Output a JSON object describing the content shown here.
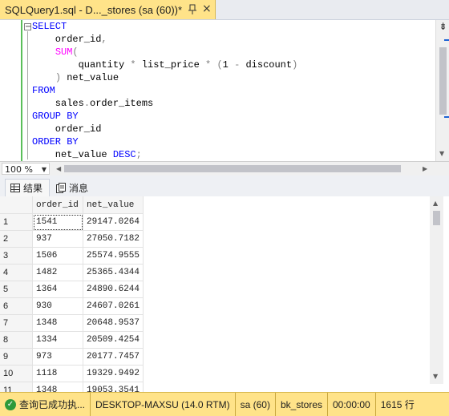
{
  "tab": {
    "title": "SQLQuery1.sql - D..._stores (sa (60))*",
    "close": "×"
  },
  "editor": {
    "lines": [
      [
        {
          "t": "SELECT",
          "c": "kw"
        }
      ],
      [
        {
          "t": "    order_id",
          "c": "plain"
        },
        {
          "t": ",",
          "c": "op"
        }
      ],
      [
        {
          "t": "    ",
          "c": "plain"
        },
        {
          "t": "SUM",
          "c": "fn"
        },
        {
          "t": "(",
          "c": "op"
        }
      ],
      [
        {
          "t": "        quantity ",
          "c": "plain"
        },
        {
          "t": "*",
          "c": "op"
        },
        {
          "t": " list_price ",
          "c": "plain"
        },
        {
          "t": "*",
          "c": "op"
        },
        {
          "t": " ",
          "c": "plain"
        },
        {
          "t": "(",
          "c": "op"
        },
        {
          "t": "1 ",
          "c": "plain"
        },
        {
          "t": "-",
          "c": "op"
        },
        {
          "t": " discount",
          "c": "plain"
        },
        {
          "t": ")",
          "c": "op"
        }
      ],
      [
        {
          "t": "    ",
          "c": "plain"
        },
        {
          "t": ")",
          "c": "op"
        },
        {
          "t": " net_value",
          "c": "plain"
        }
      ],
      [
        {
          "t": "FROM",
          "c": "kw"
        }
      ],
      [
        {
          "t": "    sales",
          "c": "plain"
        },
        {
          "t": ".",
          "c": "op"
        },
        {
          "t": "order_items",
          "c": "plain"
        }
      ],
      [
        {
          "t": "GROUP BY",
          "c": "kw"
        }
      ],
      [
        {
          "t": "    order_id",
          "c": "plain"
        }
      ],
      [
        {
          "t": "ORDER BY",
          "c": "kw"
        }
      ],
      [
        {
          "t": "    net_value ",
          "c": "plain"
        },
        {
          "t": "DESC",
          "c": "kw"
        },
        {
          "t": ";",
          "c": "op"
        }
      ]
    ]
  },
  "zoom": {
    "value": "100 %"
  },
  "results_tabs": {
    "results": "结果",
    "messages": "消息"
  },
  "grid": {
    "columns": [
      "order_id",
      "net_value"
    ],
    "rows": [
      {
        "n": "1",
        "order_id": "1541",
        "net_value": "29147.0264"
      },
      {
        "n": "2",
        "order_id": "937",
        "net_value": "27050.7182"
      },
      {
        "n": "3",
        "order_id": "1506",
        "net_value": "25574.9555"
      },
      {
        "n": "4",
        "order_id": "1482",
        "net_value": "25365.4344"
      },
      {
        "n": "5",
        "order_id": "1364",
        "net_value": "24890.6244"
      },
      {
        "n": "6",
        "order_id": "930",
        "net_value": "24607.0261"
      },
      {
        "n": "7",
        "order_id": "1348",
        "net_value": "20648.9537"
      },
      {
        "n": "8",
        "order_id": "1334",
        "net_value": "20509.4254"
      },
      {
        "n": "9",
        "order_id": "973",
        "net_value": "20177.7457"
      },
      {
        "n": "10",
        "order_id": "1118",
        "net_value": "19329.9492"
      },
      {
        "n": "11",
        "order_id": "1348",
        "net_value": "19053.3541"
      }
    ]
  },
  "status": {
    "message": "查询已成功执...",
    "server": "DESKTOP-MAXSU (14.0 RTM)",
    "user": "sa (60)",
    "database": "bk_stores",
    "time": "00:00:00",
    "rows": "1615 行"
  },
  "colors": {
    "accent": "#ffe389",
    "keyword": "#0000ff",
    "function": "#ff00ff"
  }
}
